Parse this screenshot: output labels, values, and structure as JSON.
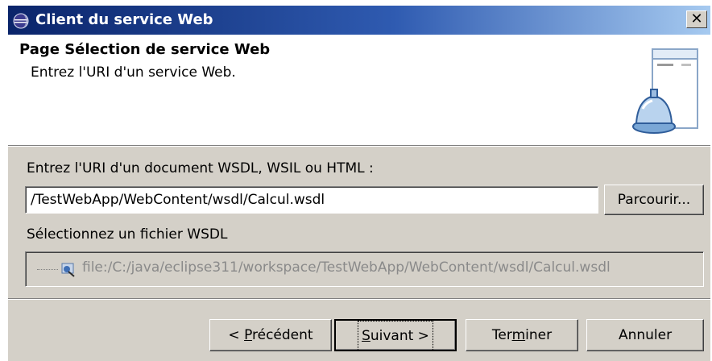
{
  "window": {
    "title": "Client du service Web",
    "close_glyph": "✕"
  },
  "header": {
    "title": "Page Sélection de service Web",
    "description": "Entrez l'URI d'un service Web."
  },
  "form": {
    "uri_label": "Entrez l'URI d'un document WSDL, WSIL ou HTML :",
    "uri_value": "/TestWebApp/WebContent/wsdl/Calcul.wsdl",
    "browse_label": "Parcourir...",
    "select_label": "Sélectionnez un fichier WSDL",
    "tree_item": "file:/C:/java/eclipse311/workspace/TestWebApp/WebContent/wsdl/Calcul.wsdl"
  },
  "buttons": {
    "back_pre": "< ",
    "back_mnemonic": "P",
    "back_post": "récédent",
    "next_mnemonic": "S",
    "next_post": "uivant >",
    "finish_pre": "Ter",
    "finish_mnemonic": "m",
    "finish_post": "iner",
    "cancel": "Annuler"
  },
  "colors": {
    "title_gradient_start": "#0a246a",
    "title_gradient_end": "#a6caf0",
    "dialog_bg": "#d4d0c8"
  }
}
